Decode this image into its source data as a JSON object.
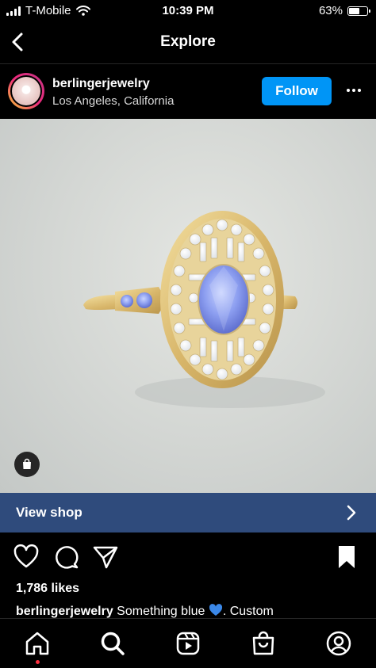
{
  "status_bar": {
    "carrier": "T-Mobile",
    "time": "10:39 PM",
    "battery": "63%",
    "battery_level": 0.63,
    "icons": [
      "signal-icon",
      "wifi-icon",
      "battery-icon"
    ]
  },
  "nav": {
    "title": "Explore",
    "back_icon": "chevron-left-icon"
  },
  "post": {
    "username": "berlingerjewelry",
    "location": "Los Angeles, California",
    "follow_label": "Follow",
    "more_icon": "ellipsis-icon",
    "image_subject": "oval diamond cluster ring with blue sapphire",
    "shop_tag_icon": "shopping-bag-icon",
    "view_shop_label": "View shop",
    "view_shop_icon": "chevron-right-icon",
    "likes": "1,786 likes",
    "caption_user": "berlingerjewelry",
    "caption_text_before": "Something blue",
    "caption_emoji": "blue-heart-icon",
    "caption_text_after": ". Custom"
  },
  "actions": [
    "heart-icon",
    "comment-icon",
    "share-icon",
    "bookmark-icon"
  ],
  "tab_bar": [
    "home-icon",
    "search-icon",
    "reels-icon",
    "shop-icon",
    "profile-icon"
  ],
  "colors": {
    "follow_button": "#0095f6",
    "view_shop_bar": "#2f4b7c",
    "notification_dot": "#ff3040"
  }
}
